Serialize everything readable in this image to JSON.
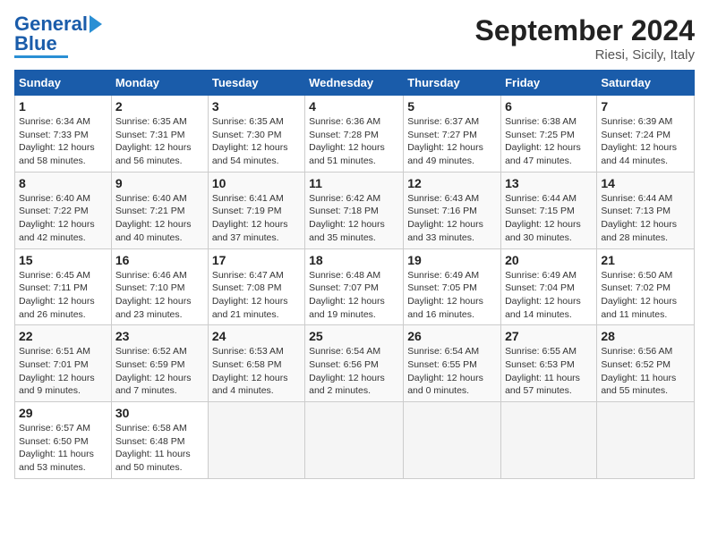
{
  "logo": {
    "line1": "General",
    "line2": "Blue"
  },
  "title": "September 2024",
  "subtitle": "Riesi, Sicily, Italy",
  "days_of_week": [
    "Sunday",
    "Monday",
    "Tuesday",
    "Wednesday",
    "Thursday",
    "Friday",
    "Saturday"
  ],
  "weeks": [
    [
      {
        "num": "1",
        "sunrise": "6:34 AM",
        "sunset": "7:33 PM",
        "daylight": "12 hours and 58 minutes."
      },
      {
        "num": "2",
        "sunrise": "6:35 AM",
        "sunset": "7:31 PM",
        "daylight": "12 hours and 56 minutes."
      },
      {
        "num": "3",
        "sunrise": "6:35 AM",
        "sunset": "7:30 PM",
        "daylight": "12 hours and 54 minutes."
      },
      {
        "num": "4",
        "sunrise": "6:36 AM",
        "sunset": "7:28 PM",
        "daylight": "12 hours and 51 minutes."
      },
      {
        "num": "5",
        "sunrise": "6:37 AM",
        "sunset": "7:27 PM",
        "daylight": "12 hours and 49 minutes."
      },
      {
        "num": "6",
        "sunrise": "6:38 AM",
        "sunset": "7:25 PM",
        "daylight": "12 hours and 47 minutes."
      },
      {
        "num": "7",
        "sunrise": "6:39 AM",
        "sunset": "7:24 PM",
        "daylight": "12 hours and 44 minutes."
      }
    ],
    [
      {
        "num": "8",
        "sunrise": "6:40 AM",
        "sunset": "7:22 PM",
        "daylight": "12 hours and 42 minutes."
      },
      {
        "num": "9",
        "sunrise": "6:40 AM",
        "sunset": "7:21 PM",
        "daylight": "12 hours and 40 minutes."
      },
      {
        "num": "10",
        "sunrise": "6:41 AM",
        "sunset": "7:19 PM",
        "daylight": "12 hours and 37 minutes."
      },
      {
        "num": "11",
        "sunrise": "6:42 AM",
        "sunset": "7:18 PM",
        "daylight": "12 hours and 35 minutes."
      },
      {
        "num": "12",
        "sunrise": "6:43 AM",
        "sunset": "7:16 PM",
        "daylight": "12 hours and 33 minutes."
      },
      {
        "num": "13",
        "sunrise": "6:44 AM",
        "sunset": "7:15 PM",
        "daylight": "12 hours and 30 minutes."
      },
      {
        "num": "14",
        "sunrise": "6:44 AM",
        "sunset": "7:13 PM",
        "daylight": "12 hours and 28 minutes."
      }
    ],
    [
      {
        "num": "15",
        "sunrise": "6:45 AM",
        "sunset": "7:11 PM",
        "daylight": "12 hours and 26 minutes."
      },
      {
        "num": "16",
        "sunrise": "6:46 AM",
        "sunset": "7:10 PM",
        "daylight": "12 hours and 23 minutes."
      },
      {
        "num": "17",
        "sunrise": "6:47 AM",
        "sunset": "7:08 PM",
        "daylight": "12 hours and 21 minutes."
      },
      {
        "num": "18",
        "sunrise": "6:48 AM",
        "sunset": "7:07 PM",
        "daylight": "12 hours and 19 minutes."
      },
      {
        "num": "19",
        "sunrise": "6:49 AM",
        "sunset": "7:05 PM",
        "daylight": "12 hours and 16 minutes."
      },
      {
        "num": "20",
        "sunrise": "6:49 AM",
        "sunset": "7:04 PM",
        "daylight": "12 hours and 14 minutes."
      },
      {
        "num": "21",
        "sunrise": "6:50 AM",
        "sunset": "7:02 PM",
        "daylight": "12 hours and 11 minutes."
      }
    ],
    [
      {
        "num": "22",
        "sunrise": "6:51 AM",
        "sunset": "7:01 PM",
        "daylight": "12 hours and 9 minutes."
      },
      {
        "num": "23",
        "sunrise": "6:52 AM",
        "sunset": "6:59 PM",
        "daylight": "12 hours and 7 minutes."
      },
      {
        "num": "24",
        "sunrise": "6:53 AM",
        "sunset": "6:58 PM",
        "daylight": "12 hours and 4 minutes."
      },
      {
        "num": "25",
        "sunrise": "6:54 AM",
        "sunset": "6:56 PM",
        "daylight": "12 hours and 2 minutes."
      },
      {
        "num": "26",
        "sunrise": "6:54 AM",
        "sunset": "6:55 PM",
        "daylight": "12 hours and 0 minutes."
      },
      {
        "num": "27",
        "sunrise": "6:55 AM",
        "sunset": "6:53 PM",
        "daylight": "11 hours and 57 minutes."
      },
      {
        "num": "28",
        "sunrise": "6:56 AM",
        "sunset": "6:52 PM",
        "daylight": "11 hours and 55 minutes."
      }
    ],
    [
      {
        "num": "29",
        "sunrise": "6:57 AM",
        "sunset": "6:50 PM",
        "daylight": "11 hours and 53 minutes."
      },
      {
        "num": "30",
        "sunrise": "6:58 AM",
        "sunset": "6:48 PM",
        "daylight": "11 hours and 50 minutes."
      },
      null,
      null,
      null,
      null,
      null
    ]
  ]
}
